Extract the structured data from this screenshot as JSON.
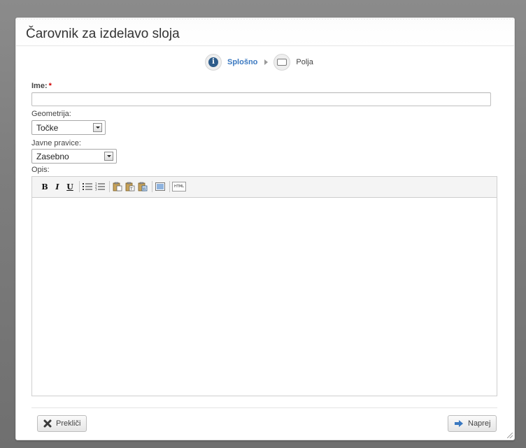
{
  "dialog": {
    "title": "Čarovnik za izdelavo sloja"
  },
  "steps": [
    {
      "label": "Splošno",
      "icon": "info-icon",
      "active": true
    },
    {
      "label": "Polja",
      "icon": "fields-icon",
      "active": false
    }
  ],
  "form": {
    "name_label": "Ime:",
    "required_mark": "*",
    "name_value": "",
    "geometry_label": "Geometrija:",
    "geometry_value": "Točke",
    "permissions_label": "Javne pravice:",
    "permissions_value": "Zasebno",
    "description_label": "Opis:"
  },
  "toolbar": {
    "bold": "B",
    "italic": "I",
    "underline": "U",
    "html": "HTML",
    "buttons": [
      "bold",
      "italic",
      "underline",
      "bullet-list",
      "numbered-list",
      "paste",
      "paste-text",
      "paste-word",
      "source-view",
      "html"
    ]
  },
  "footer": {
    "cancel_label": "Prekliči",
    "next_label": "Naprej"
  },
  "colors": {
    "accent": "#3a78c0",
    "required": "#d00000",
    "background": "#7d7d7d"
  }
}
